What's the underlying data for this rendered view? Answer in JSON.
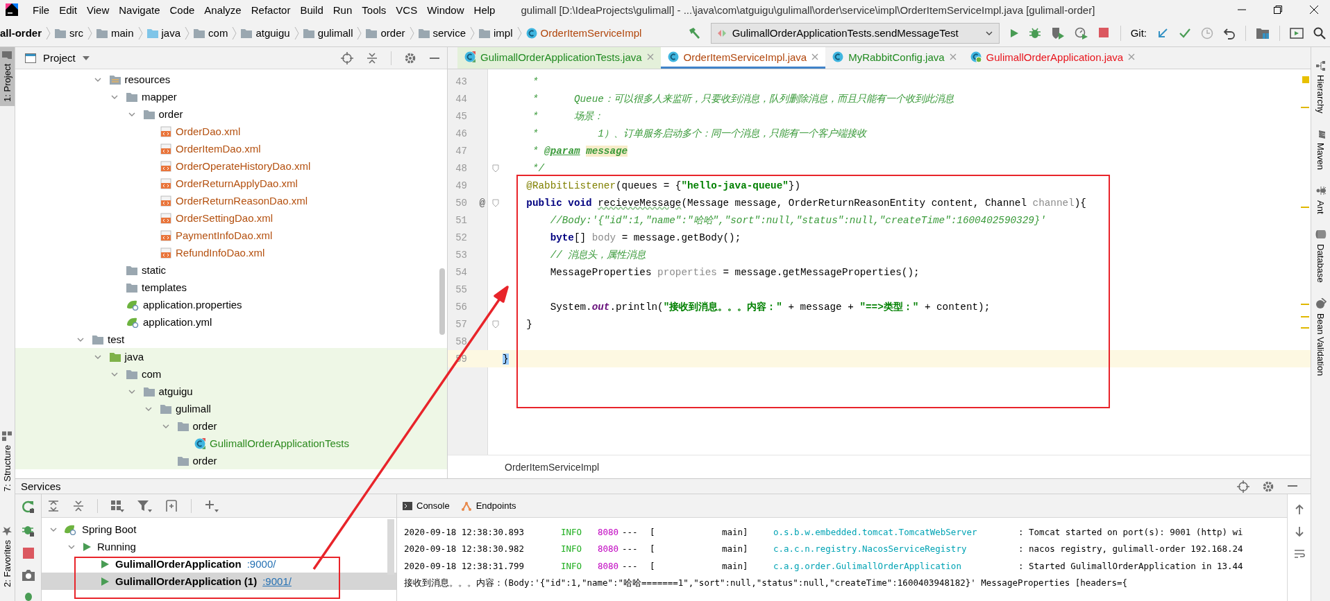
{
  "window": {
    "title": "gulimall [D:\\IdeaProjects\\gulimall] - ...\\java\\com\\atguigu\\gulimall\\order\\service\\impl\\OrderItemServiceImpl.java [gulimall-order]"
  },
  "menu": [
    "File",
    "Edit",
    "View",
    "Navigate",
    "Code",
    "Analyze",
    "Refactor",
    "Build",
    "Run",
    "Tools",
    "VCS",
    "Window",
    "Help"
  ],
  "breadcrumbs": [
    {
      "label": "all-order",
      "kind": "module",
      "color": "#000000"
    },
    {
      "label": "src",
      "kind": "folder",
      "color": "#000000"
    },
    {
      "label": "main",
      "kind": "folder",
      "color": "#000000"
    },
    {
      "label": "java",
      "kind": "source-folder",
      "color": "#000000"
    },
    {
      "label": "com",
      "kind": "folder",
      "color": "#000000"
    },
    {
      "label": "atguigu",
      "kind": "folder",
      "color": "#000000"
    },
    {
      "label": "gulimall",
      "kind": "folder",
      "color": "#000000"
    },
    {
      "label": "order",
      "kind": "folder",
      "color": "#000000"
    },
    {
      "label": "service",
      "kind": "folder",
      "color": "#000000"
    },
    {
      "label": "impl",
      "kind": "folder",
      "color": "#000000"
    },
    {
      "label": "OrderItemServiceImpl",
      "kind": "class",
      "color": "#b1460c"
    }
  ],
  "run_config": {
    "label": "GulimallOrderApplicationTests.sendMessageTest"
  },
  "vcs_label": "Git:",
  "left_strip": [
    {
      "label": "1: Project",
      "kind": "project",
      "selected": true
    },
    {
      "label": "7: Structure",
      "kind": "structure",
      "selected": false
    },
    {
      "label": "2: Favorites",
      "kind": "favorites",
      "selected": false
    }
  ],
  "right_strip": [
    {
      "label": "Hierarchy",
      "kind": "hierarchy"
    },
    {
      "label": "Maven",
      "kind": "maven"
    },
    {
      "label": "Ant",
      "kind": "ant"
    },
    {
      "label": "Database",
      "kind": "database"
    },
    {
      "label": "Bean Validation",
      "kind": "bean"
    }
  ],
  "project_panel": {
    "title": "Project",
    "tree": [
      {
        "kind": "hidden-parent",
        "children": [
          {
            "label": "resources",
            "kind": "resources-folder",
            "expanded": true,
            "children": [
              {
                "label": "mapper",
                "kind": "folder",
                "expanded": true,
                "children": [
                  {
                    "label": "order",
                    "kind": "folder",
                    "expanded": true,
                    "children": [
                      {
                        "label": "OrderDao.xml",
                        "kind": "xml",
                        "color": "#b4500f"
                      },
                      {
                        "label": "OrderItemDao.xml",
                        "kind": "xml",
                        "color": "#b4500f"
                      },
                      {
                        "label": "OrderOperateHistoryDao.xml",
                        "kind": "xml",
                        "color": "#b4500f"
                      },
                      {
                        "label": "OrderReturnApplyDao.xml",
                        "kind": "xml",
                        "color": "#b4500f"
                      },
                      {
                        "label": "OrderReturnReasonDao.xml",
                        "kind": "xml",
                        "color": "#b4500f"
                      },
                      {
                        "label": "OrderSettingDao.xml",
                        "kind": "xml",
                        "color": "#b4500f"
                      },
                      {
                        "label": "PaymentInfoDao.xml",
                        "kind": "xml",
                        "color": "#b4500f"
                      },
                      {
                        "label": "RefundInfoDao.xml",
                        "kind": "xml",
                        "color": "#b4500f"
                      }
                    ]
                  }
                ]
              },
              {
                "label": "static",
                "kind": "folder"
              },
              {
                "label": "templates",
                "kind": "folder"
              },
              {
                "label": "application.properties",
                "kind": "spring-config"
              },
              {
                "label": "application.yml",
                "kind": "spring-config"
              }
            ]
          }
        ]
      },
      {
        "label": "test",
        "kind": "folder",
        "expanded": true,
        "children": [
          {
            "label": "java",
            "kind": "test-source-folder",
            "expanded": true,
            "test_scope": true,
            "children": [
              {
                "label": "com",
                "kind": "folder",
                "expanded": true,
                "children": [
                  {
                    "label": "atguigu",
                    "kind": "folder",
                    "expanded": true,
                    "children": [
                      {
                        "label": "gulimall",
                        "kind": "folder",
                        "expanded": true,
                        "children": [
                          {
                            "label": "order",
                            "kind": "folder",
                            "expanded": true,
                            "children": [
                              {
                                "label": "GulimallOrderApplicationTests",
                                "kind": "test-class",
                                "color": "#2c8a1e"
                              }
                            ]
                          },
                          {
                            "label": "order",
                            "kind": "folder"
                          }
                        ]
                      }
                    ]
                  }
                ]
              }
            ]
          }
        ]
      }
    ]
  },
  "editor": {
    "tabs": [
      {
        "label": "GulimallOrderApplicationTests.java",
        "kind": "test-class",
        "selected": false,
        "test_scope": true,
        "color": "#208a20"
      },
      {
        "label": "OrderItemServiceImpl.java",
        "kind": "class",
        "selected": true,
        "test_scope": false,
        "color": "#b1460c"
      },
      {
        "label": "MyRabbitConfig.java",
        "kind": "class",
        "selected": false,
        "test_scope": false,
        "color": "#208a20"
      },
      {
        "label": "GulimallOrderApplication.java",
        "kind": "app-class",
        "selected": false,
        "test_scope": false,
        "color": "#e8141c"
      }
    ],
    "lines": [
      {
        "number": "43",
        "current": false,
        "fold": false,
        "tokens": [
          {
            "kind": "doc",
            "text": "     *"
          }
        ]
      },
      {
        "number": "44",
        "current": false,
        "fold": false,
        "tokens": [
          {
            "kind": "doc",
            "text": "     *      Queue：可以很多人来监听，只要收到消息，队列删除消息，而且只能有一个收到此消息"
          }
        ]
      },
      {
        "number": "45",
        "current": false,
        "fold": false,
        "tokens": [
          {
            "kind": "doc",
            "text": "     *      场景："
          }
        ]
      },
      {
        "number": "46",
        "current": false,
        "fold": false,
        "tokens": [
          {
            "kind": "doc",
            "text": "     *          1）、订单服务启动多个：同一个消息，只能有一个客户端接收"
          }
        ]
      },
      {
        "number": "47",
        "current": false,
        "fold": false,
        "tokens": [
          {
            "kind": "doc",
            "text": "     * "
          },
          {
            "kind": "doctag",
            "text": "@param"
          },
          {
            "kind": "docparam",
            "text": "message"
          }
        ]
      },
      {
        "number": "48",
        "current": false,
        "fold": true,
        "tokens": [
          {
            "kind": "doc",
            "text": "     */"
          }
        ]
      },
      {
        "number": "49",
        "current": false,
        "fold": false,
        "tokens": [
          {
            "kind": "annotation",
            "text": "    @RabbitListener"
          },
          {
            "kind": "plain",
            "text": "(queues = {"
          },
          {
            "kind": "str",
            "text": "\"hello-java-queue\""
          },
          {
            "kind": "plain",
            "text": "})"
          }
        ]
      },
      {
        "number": "50",
        "current": false,
        "fold": true,
        "gutter_mark": "@",
        "tokens": [
          {
            "kind": "kw",
            "text": "    public void "
          },
          {
            "kind": "typo",
            "text": "recieveMessage"
          },
          {
            "kind": "plain",
            "text": "(Message message, OrderReturnReasonEntity content, Channel "
          },
          {
            "kind": "unused",
            "text": "channel"
          },
          {
            "kind": "plain",
            "text": "){"
          }
        ]
      },
      {
        "number": "51",
        "current": false,
        "fold": false,
        "tokens": [
          {
            "kind": "comment",
            "text": "        //Body:'{\"id\":1,\"name\":\"哈哈\",\"sort\":null,\"status\":null,\"createTime\":1600402590329}'"
          }
        ]
      },
      {
        "number": "52",
        "current": false,
        "fold": false,
        "tokens": [
          {
            "kind": "kw",
            "text": "        byte"
          },
          {
            "kind": "plain",
            "text": "[] "
          },
          {
            "kind": "unused",
            "text": "body"
          },
          {
            "kind": "plain",
            "text": " = message.getBody();"
          }
        ]
      },
      {
        "number": "53",
        "current": false,
        "fold": false,
        "tokens": [
          {
            "kind": "comment",
            "text": "        // 消息头，属性消息"
          }
        ]
      },
      {
        "number": "54",
        "current": false,
        "fold": false,
        "tokens": [
          {
            "kind": "plain",
            "text": "        MessageProperties "
          },
          {
            "kind": "unused",
            "text": "properties"
          },
          {
            "kind": "plain",
            "text": " = message.getMessageProperties();"
          }
        ]
      },
      {
        "number": "55",
        "current": false,
        "fold": false
      },
      {
        "number": "56",
        "current": false,
        "fold": false,
        "tokens": [
          {
            "kind": "plain",
            "text": "        System."
          },
          {
            "kind": "static",
            "text": "out"
          },
          {
            "kind": "plain",
            "text": ".println("
          },
          {
            "kind": "str",
            "text": "\"接收到消息。。。内容：\""
          },
          {
            "kind": "plain",
            "text": " + message + "
          },
          {
            "kind": "str",
            "text": "\"==>类型：\""
          },
          {
            "kind": "plain",
            "text": " + content);"
          }
        ]
      },
      {
        "number": "57",
        "current": false,
        "fold": true,
        "tokens": [
          {
            "kind": "plain",
            "text": "    }"
          }
        ]
      },
      {
        "number": "58",
        "current": false,
        "fold": false
      },
      {
        "number": "59",
        "current": true,
        "fold": false,
        "tokens": [
          {
            "kind": "brace",
            "text": "}"
          }
        ]
      }
    ],
    "breadcrumb": "OrderItemServiceImpl"
  },
  "services": {
    "title": "Services",
    "tree": [
      {
        "label": "Spring Boot",
        "kind": "spring-boot",
        "expanded": true,
        "selected": false,
        "children": [
          {
            "label": "Running",
            "kind": "running",
            "expanded": true,
            "selected": false,
            "children": [
              {
                "label": "GulimallOrderApplication",
                "kind": "app",
                "port": ":9000/",
                "selected": false,
                "hovered": false
              },
              {
                "label": "GulimallOrderApplication (1)",
                "kind": "app",
                "port": ":9001/",
                "selected": true,
                "hovered": true
              }
            ]
          }
        ]
      }
    ],
    "console_tabs": [
      {
        "label": "Console",
        "kind": "console"
      },
      {
        "label": "Endpoints",
        "kind": "endpoints"
      }
    ],
    "log": [
      {
        "kind": "spring",
        "date": "2020-09-18 12:38:30.893",
        "level": "INFO",
        "pid": "8080",
        "sep": "---",
        "bracket": "[",
        "thread": "main]",
        "logger": "o.s.b.w.embedded.tomcat.TomcatWebServer",
        "message": ": Tomcat started on port(s): 9001 (http) wi"
      },
      {
        "kind": "spring",
        "date": "2020-09-18 12:38:30.982",
        "level": "INFO",
        "pid": "8080",
        "sep": "---",
        "bracket": "[",
        "thread": "main]",
        "logger": "c.a.c.n.registry.NacosServiceRegistry",
        "message": ": nacos registry, gulimall-order 192.168.24"
      },
      {
        "kind": "spring",
        "date": "2020-09-18 12:38:31.799",
        "level": "INFO",
        "pid": "8080",
        "sep": "---",
        "bracket": "[",
        "thread": "main]",
        "logger": "c.a.g.order.GulimallOrderApplication",
        "message": ": Started GulimallOrderApplication in 13.44"
      },
      {
        "kind": "plain",
        "text": "接收到消息。。。内容：(Body:'{\"id\":1,\"name\":\"哈哈=======1\",\"sort\":null,\"status\":null,\"createTime\":1600403948182}' MessageProperties [headers={"
      }
    ]
  },
  "annotations": [
    {
      "kind": "code-box"
    },
    {
      "kind": "arrow"
    },
    {
      "kind": "services-box"
    }
  ]
}
